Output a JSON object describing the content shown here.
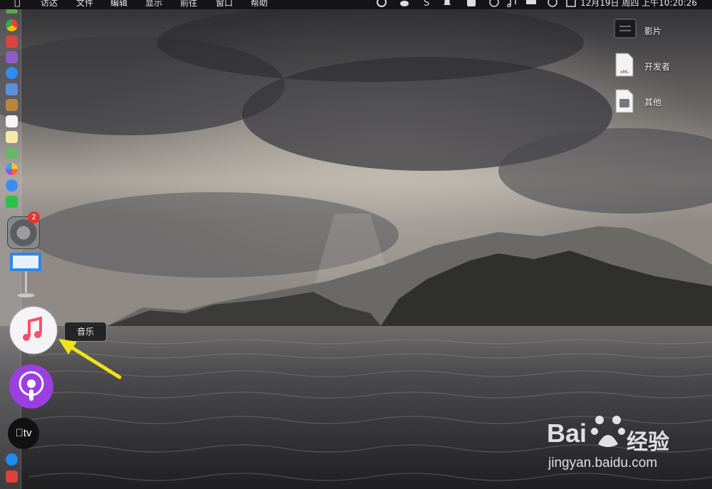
{
  "menubar": {
    "app_menus": [
      "访达",
      "文件",
      "编辑",
      "显示",
      "前往",
      "窗口",
      "帮助"
    ],
    "clock": "12月19日 周四 上午10:20:26"
  },
  "dock": {
    "settings_badge": "2",
    "tooltip": "音乐",
    "appletv_label": "tv"
  },
  "desktop": {
    "items": [
      {
        "label": "影片"
      },
      {
        "label": "开发者"
      },
      {
        "label": "其他"
      }
    ],
    "dev_icon_text": "xML"
  },
  "watermark": {
    "brand": "Bai",
    "brand_cn": "经验",
    "url": "jingyan.baidu.com"
  },
  "colors": {
    "annotation_arrow": "#f0e21a",
    "badge": "#e8362f",
    "music_icon": "#fb4e6a",
    "podcasts": "#9c3fe0"
  }
}
